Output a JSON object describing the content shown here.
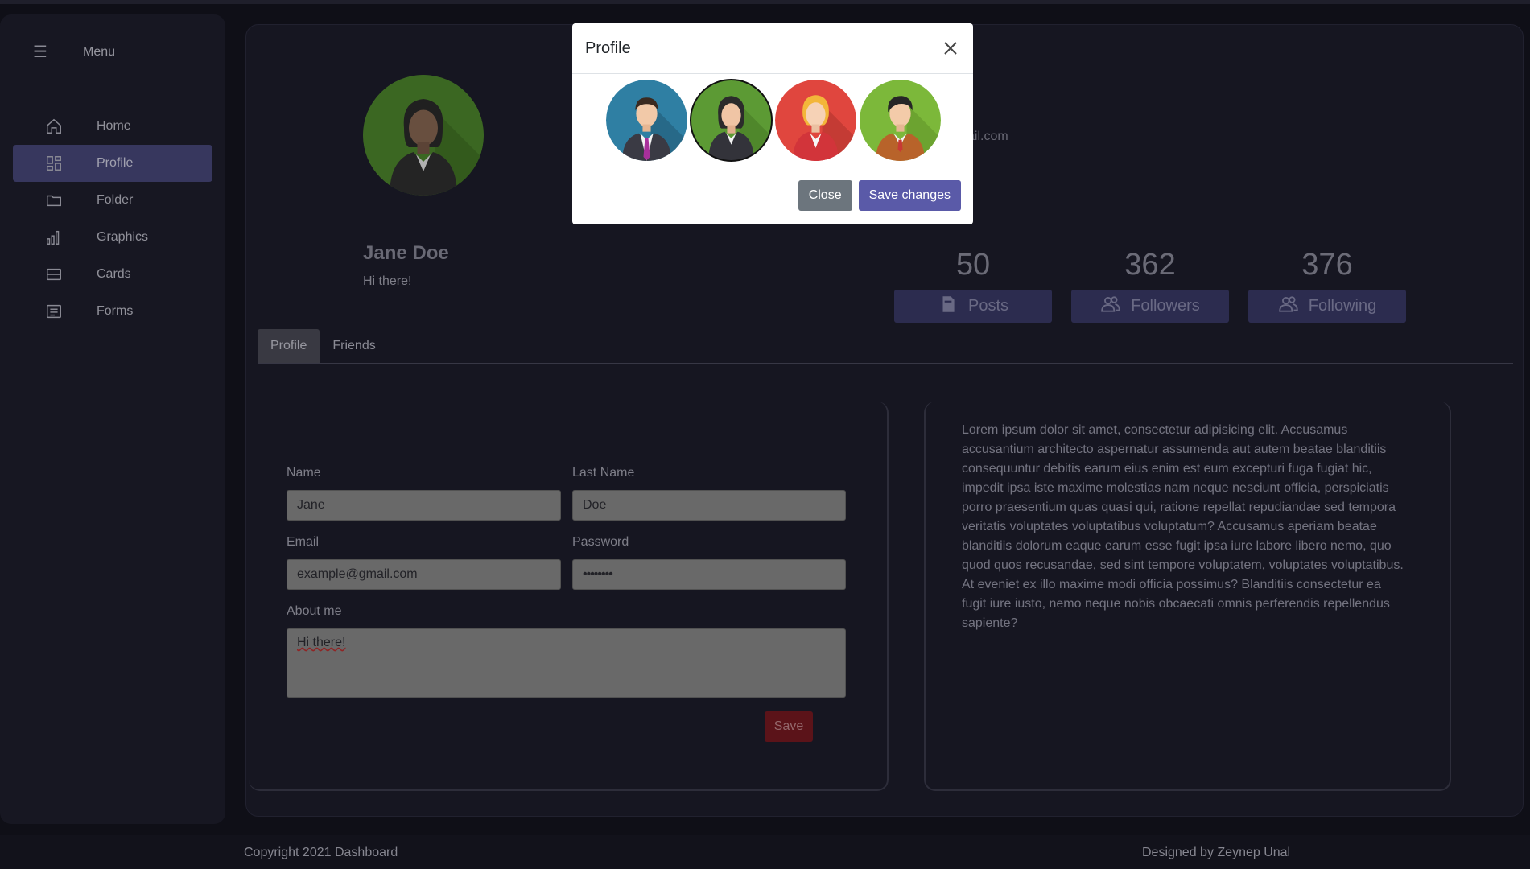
{
  "sidebar": {
    "menu_label": "Menu",
    "items": [
      {
        "label": "Home",
        "icon": "home-icon"
      },
      {
        "label": "Profile",
        "icon": "dashboard-icon",
        "active": true
      },
      {
        "label": "Folder",
        "icon": "folder-icon"
      },
      {
        "label": "Graphics",
        "icon": "bar-chart-icon"
      },
      {
        "label": "Cards",
        "icon": "card-icon"
      },
      {
        "label": "Forms",
        "icon": "form-icon"
      }
    ]
  },
  "profile": {
    "name": "Jane Doe",
    "status": "Hi there!",
    "email_fragment": "ail.com"
  },
  "stats": [
    {
      "value": "50",
      "label": "Posts",
      "icon": "document-icon"
    },
    {
      "value": "362",
      "label": "Followers",
      "icon": "users-icon"
    },
    {
      "value": "376",
      "label": "Following",
      "icon": "users-icon"
    }
  ],
  "tabs": [
    {
      "label": "Profile",
      "active": true
    },
    {
      "label": "Friends"
    }
  ],
  "form": {
    "name_label": "Name",
    "name_value": "Jane",
    "lastname_label": "Last Name",
    "lastname_value": "Doe",
    "email_label": "Email",
    "email_value": "example@gmail.com",
    "password_label": "Password",
    "password_value": "••••••••",
    "about_label": "About me",
    "about_value": "Hi there!",
    "save_label": "Save"
  },
  "about_text": "Lorem ipsum dolor sit amet, consectetur adipisicing elit. Accusamus accusantium architecto aspernatur assumenda aut autem beatae blanditiis consequuntur debitis earum eius enim est eum excepturi fuga fugiat hic, impedit ipsa iste maxime molestias nam neque nesciunt officia, perspiciatis porro praesentium quas quasi qui, ratione repellat repudiandae sed tempora veritatis voluptates voluptatibus voluptatum? Accusamus aperiam beatae blanditiis dolorum eaque earum esse fugit ipsa iure labore libero nemo, quo quod quos recusandae, sed sint tempore voluptatem, voluptates voluptatibus. At eveniet ex illo maxime modi officia possimus? Blanditiis consectetur ea fugit iure iusto, nemo neque nobis obcaecati omnis perferendis repellendus sapiente?",
  "footer": {
    "copyright": "Copyright 2021 Dashboard",
    "designer": "Designed by Zeynep Unal"
  },
  "modal": {
    "title": "Profile",
    "close_label": "Close",
    "save_label": "Save changes",
    "avatars": [
      {
        "name": "man-suit-avatar",
        "bg": "#2f7fa3"
      },
      {
        "name": "woman-avatar",
        "bg": "#5c9a34",
        "selected": true
      },
      {
        "name": "blonde-woman-avatar",
        "bg": "#e0463e"
      },
      {
        "name": "young-man-avatar",
        "bg": "#7cb83a"
      }
    ]
  },
  "colors": {
    "accent": "#4a4a7e",
    "danger": "#7a1a22",
    "modal_primary": "#5a5aa8"
  }
}
